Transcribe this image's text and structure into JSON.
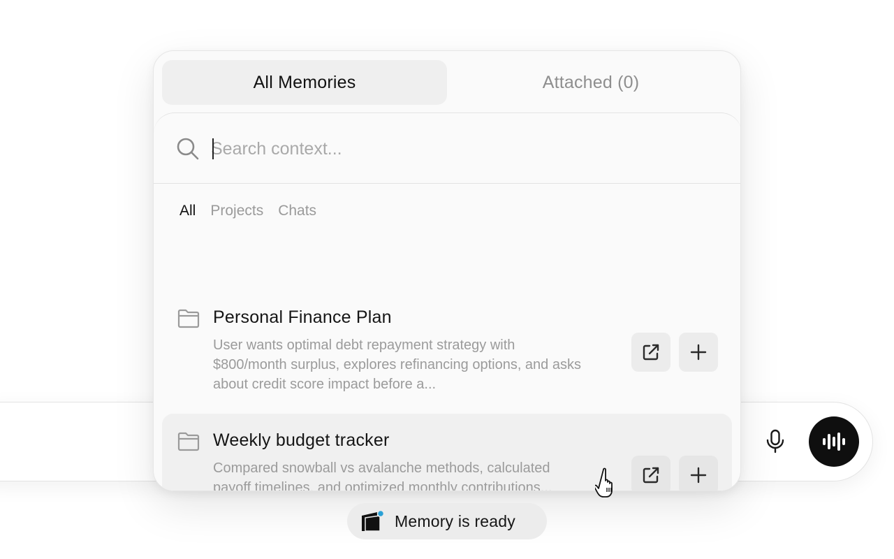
{
  "tabs": [
    {
      "label": "All Memories",
      "active": true
    },
    {
      "label": "Attached (0)",
      "active": false
    }
  ],
  "search": {
    "placeholder": "Search context...",
    "value": ""
  },
  "filters": [
    {
      "label": "All",
      "active": true
    },
    {
      "label": "Projects",
      "active": false
    },
    {
      "label": "Chats",
      "active": false
    }
  ],
  "items": [
    {
      "title": "Personal Finance Plan",
      "description": "User wants optimal debt repayment strategy with $800/month surplus, explores refinancing options, and asks about credit score impact before a...",
      "icon": "folder-icon"
    },
    {
      "title": "Weekly budget tracker",
      "description": "Compared snowball vs avalanche methods, calculated payoff timelines, and optimized monthly contributions...",
      "icon": "folder-icon",
      "hovered": true
    }
  ],
  "status": {
    "text": "Memory is ready",
    "icon": "memory-icon",
    "dot_color": "#2aa1d6"
  },
  "composer": {
    "mic_icon": "microphone-icon",
    "voice_icon": "voice-waveform-icon"
  },
  "colors": {
    "accent_dark": "#0f0f0f",
    "muted_text": "#9b9b9b",
    "panel_bg": "#fafafa"
  }
}
